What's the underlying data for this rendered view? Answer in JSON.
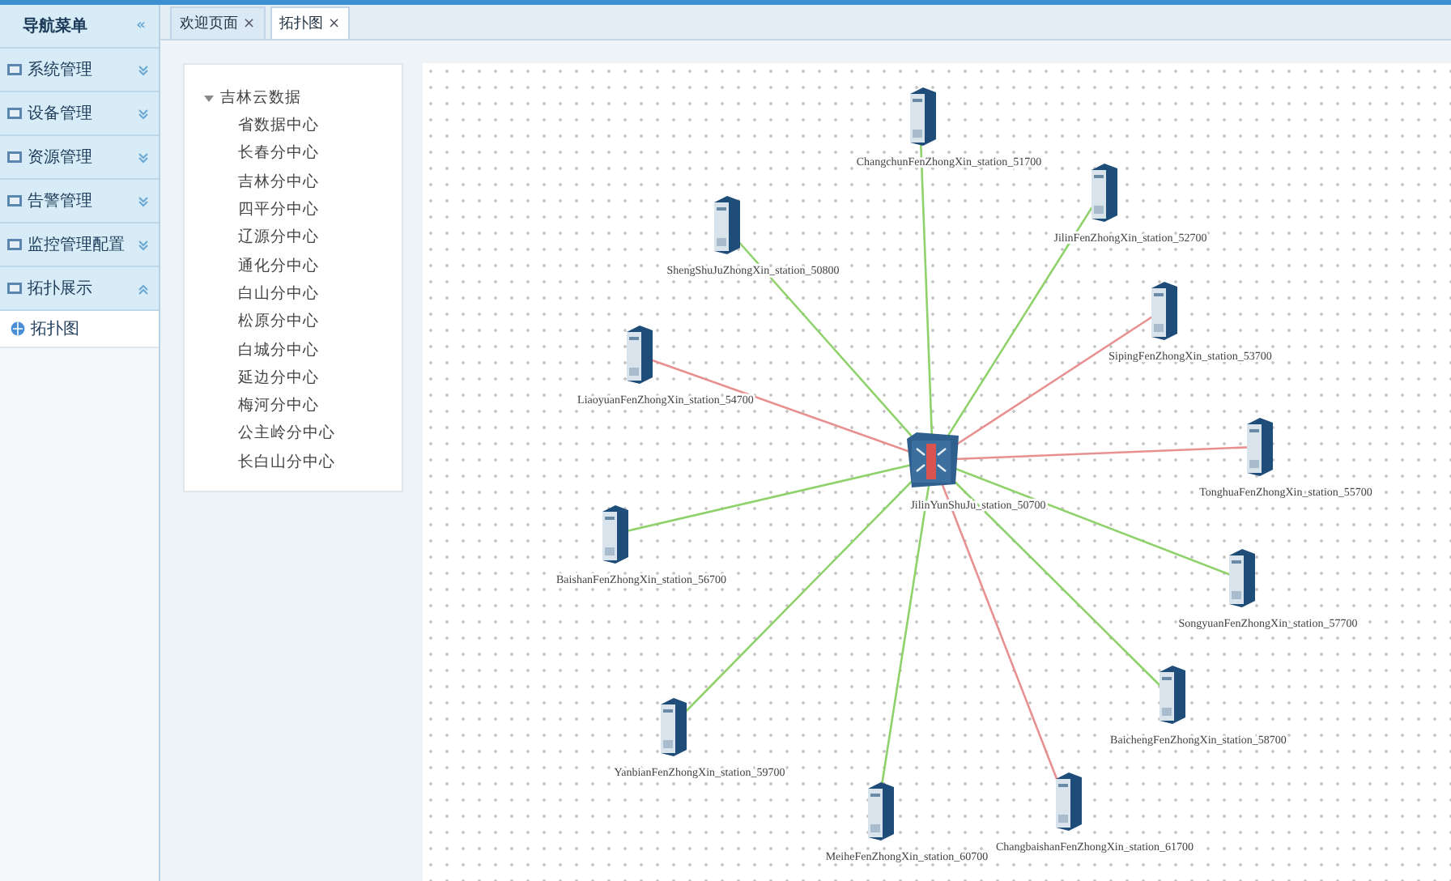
{
  "sidebar": {
    "title": "导航菜单",
    "collapse": "«",
    "groups": [
      {
        "label": "系统管理",
        "expanded": false
      },
      {
        "label": "设备管理",
        "expanded": false
      },
      {
        "label": "资源管理",
        "expanded": false
      },
      {
        "label": "告警管理",
        "expanded": false
      },
      {
        "label": "监控管理配置",
        "expanded": false
      },
      {
        "label": "拓扑展示",
        "expanded": true,
        "children": [
          {
            "label": "拓扑图",
            "selected": true
          }
        ]
      }
    ]
  },
  "tabs": [
    {
      "label": "欢迎页面",
      "close": "×",
      "selected": false
    },
    {
      "label": "拓扑图",
      "close": "×",
      "selected": true
    }
  ],
  "tree": {
    "root": {
      "label": "吉林云数据",
      "expanded": true,
      "children": [
        {
          "label": "省数据中心"
        },
        {
          "label": "长春分中心"
        },
        {
          "label": "吉林分中心"
        },
        {
          "label": "四平分中心"
        },
        {
          "label": "辽源分中心"
        },
        {
          "label": "通化分中心"
        },
        {
          "label": "白山分中心"
        },
        {
          "label": "松原分中心"
        },
        {
          "label": "白城分中心"
        },
        {
          "label": "延边分中心"
        },
        {
          "label": "梅河分中心"
        },
        {
          "label": "公主岭分中心"
        },
        {
          "label": "长白山分中心"
        }
      ]
    }
  },
  "topology": {
    "hub": {
      "label": "JilinYunShuJu_station_50700"
    },
    "nodes": [
      {
        "label": "ChangchunFenZhongXin_station_51700",
        "color": "#8fd16a"
      },
      {
        "label": "JilinFenZhongXin_station_52700",
        "color": "#8fd16a"
      },
      {
        "label": "ShengShuJuZhongXin_station_50800",
        "color": "#8fd16a"
      },
      {
        "label": "SipingFenZhongXin_station_53700",
        "color": "#e89090"
      },
      {
        "label": "LiaoyuanFenZhongXin_station_54700",
        "color": "#e89090"
      },
      {
        "label": "TonghuaFenZhongXin_station_55700",
        "color": "#e89090"
      },
      {
        "label": "BaishanFenZhongXin_station_56700",
        "color": "#8fd16a"
      },
      {
        "label": "SongyuanFenZhongXin_station_57700",
        "color": "#8fd16a"
      },
      {
        "label": "BaichengFenZhongXin_station_58700",
        "color": "#8fd16a"
      },
      {
        "label": "YanbianFenZhongXin_station_59700",
        "color": "#8fd16a"
      },
      {
        "label": "MeiheFenZhongXin_station_60700",
        "color": "#8fd16a"
      },
      {
        "label": "ChangbaishanFenZhongXin_station_61700",
        "color": "#e89090"
      }
    ]
  }
}
